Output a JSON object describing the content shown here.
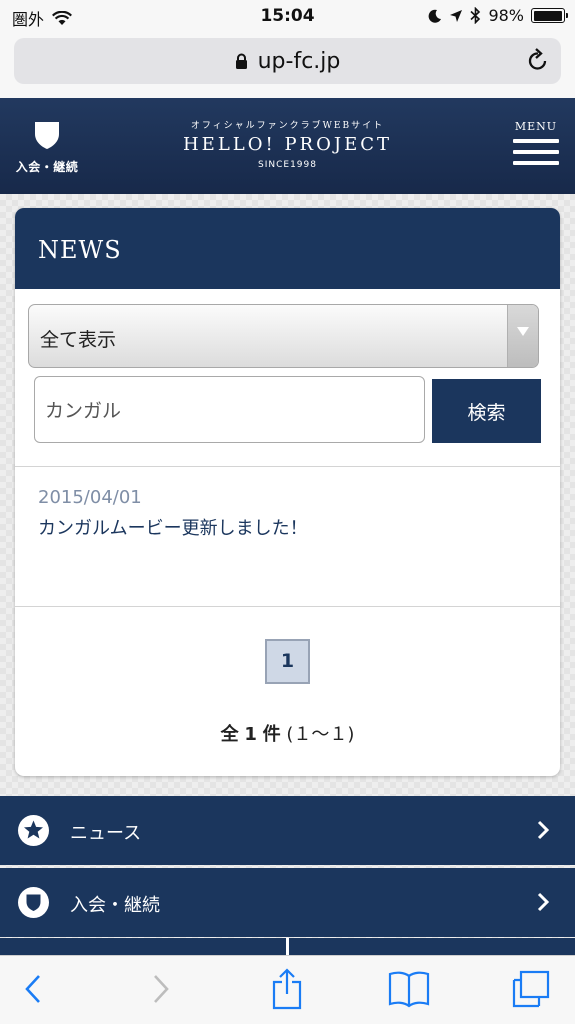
{
  "status_bar": {
    "carrier": "圏外",
    "time": "15:04",
    "battery": "98%",
    "battery_level": 0.98
  },
  "browser": {
    "url": "up-fc.jp",
    "icons": {
      "lock": "lock-icon",
      "reload": "reload-icon",
      "back": "back-icon",
      "forward": "forward-icon",
      "share": "share-icon",
      "bookmarks": "bookmarks-icon",
      "tabs": "tabs-icon"
    }
  },
  "header": {
    "join_label": "入会・継続",
    "brand_kana": "オフィシャルファンクラブWEBサイト",
    "brand_name": "HELLO! PROJECT",
    "brand_since": "SINCE1998",
    "menu_label": "MENU"
  },
  "news": {
    "title": "NEWS",
    "select_value": "全て表示",
    "search_value": "カンガル",
    "search_button": "検索",
    "items": [
      {
        "date": "2015/04/01",
        "text": "カンガルムービー更新しました！"
      }
    ],
    "pagination": {
      "current_page": "1",
      "total_prefix": "全",
      "total_count": "1",
      "total_suffix": "件",
      "range": "(１～１)"
    }
  },
  "nav": {
    "items": [
      {
        "label": "ニュース",
        "icon": "star-icon"
      },
      {
        "label": "入会・継続",
        "icon": "shield-icon"
      }
    ]
  },
  "colors": {
    "navy": "#1b365d",
    "date_gray": "#7f8ea6",
    "page_active_bg": "#cfd8e6"
  }
}
